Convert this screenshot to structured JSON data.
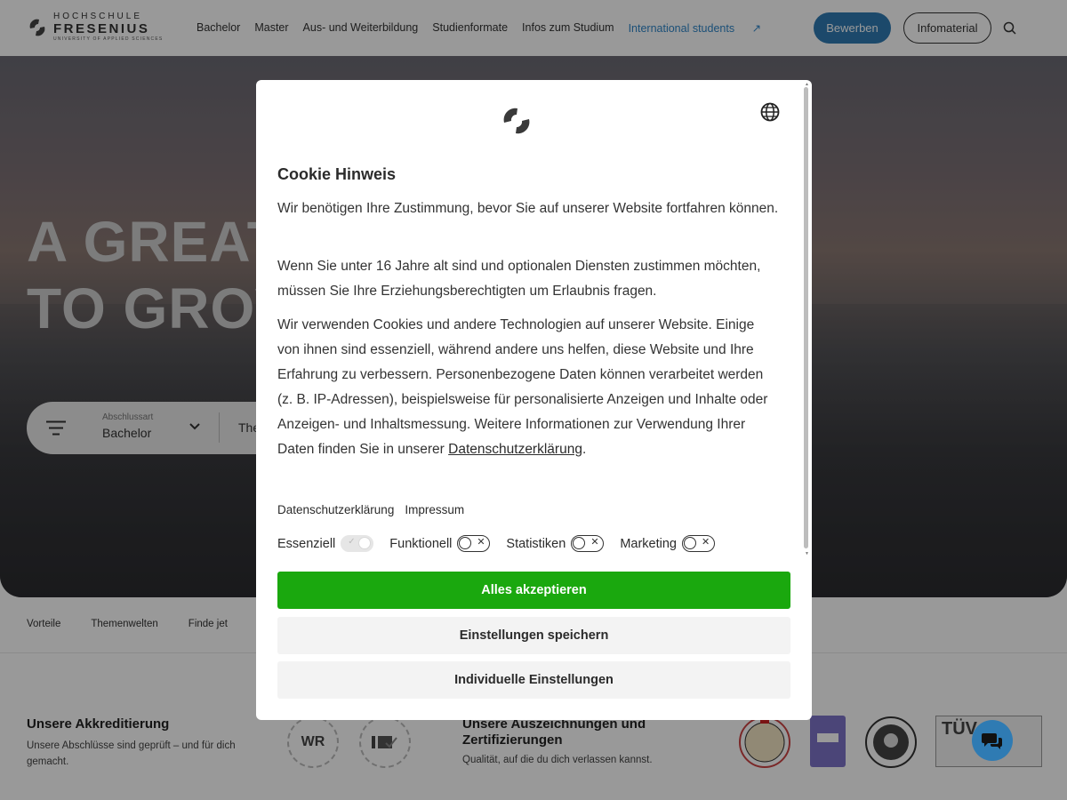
{
  "header": {
    "logo": {
      "line1": "HOCHSCHULE",
      "line2": "FRESENIUS",
      "line3": "UNIVERSITY OF APPLIED SCIENCES"
    },
    "nav": [
      "Bachelor",
      "Master",
      "Aus- und Weiterbildung",
      "Studienformate",
      "Infos zum Studium"
    ],
    "nav_international": "International students",
    "apply_label": "Bewerben",
    "info_label": "Infomaterial",
    "accent_color": "#2f7bb3"
  },
  "hero": {
    "line1": "A GREAT",
    "line2": "TO GROW",
    "filter": {
      "label": "Abschlussart",
      "value": "Bachelor",
      "value2": "The"
    }
  },
  "subnav": [
    "Vorteile",
    "Themenwelten",
    "Finde jet"
  ],
  "accreditation": {
    "title": "Unsere Akkreditierung",
    "text": "Unsere Abschlüsse sind geprüft – und für dich gemacht.",
    "seal1": "WR"
  },
  "awards": {
    "title": "Unsere Auszeichnungen und Zertifizierungen",
    "text": "Qualität, auf die du dich verlassen kannst.",
    "tuv": "TÜV"
  },
  "cookie": {
    "title": "Cookie Hinweis",
    "p1": "Wir benötigen Ihre Zustimmung, bevor Sie auf unserer Website fortfahren können.",
    "p2": "Wenn Sie unter 16 Jahre alt sind und optionalen Diensten zustimmen möchten, müssen Sie Ihre Erziehungsberechtigten um Erlaubnis fragen.",
    "p3": "Wir verwenden Cookies und andere Technologien auf unserer Website. Einige von ihnen sind essenziell, während andere uns helfen, diese Website und Ihre Erfahrung zu verbessern. Personenbezogene Daten können verarbeitet werden (z. B. IP-Adressen), beispielsweise für personalisierte Anzeigen und Inhalte oder Anzeigen- und Inhaltsmessung. Weitere Informationen zur Verwendung Ihrer Daten finden Sie in unserer",
    "p3_link": "Datenschutzerklärung",
    "p3_end": ".",
    "links": [
      "Datenschutzerklärung",
      "Impressum"
    ],
    "toggles": [
      {
        "label": "Essenziell",
        "checked": true,
        "disabled": true
      },
      {
        "label": "Funktionell",
        "checked": false
      },
      {
        "label": "Statistiken",
        "checked": false
      },
      {
        "label": "Marketing",
        "checked": false
      }
    ],
    "accept_label": "Alles akzeptieren",
    "save_label": "Einstellungen speichern",
    "individual_label": "Individuelle Einstellungen",
    "accept_color": "#1aa80e"
  }
}
